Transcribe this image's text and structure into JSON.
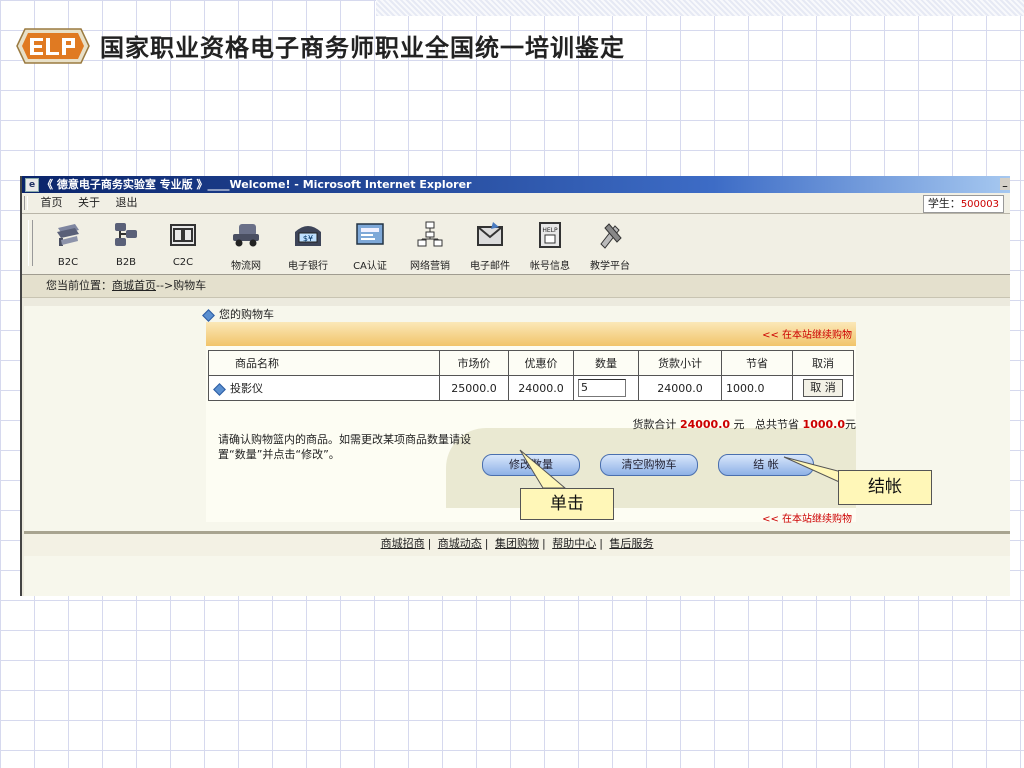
{
  "slide": {
    "title": "国家职业资格电子商务师职业全国统一培训鉴定"
  },
  "browser": {
    "window_title": "《 德意电子商务实验室 专业版 》____Welcome! - Microsoft Internet Explorer",
    "menu": [
      "首页",
      "关于",
      "退出"
    ],
    "student_label": "学生：",
    "student_id": "500003"
  },
  "toolbar": {
    "items": [
      {
        "label": "B2C",
        "icon": "b2c-icon"
      },
      {
        "label": "B2B",
        "icon": "b2b-icon"
      },
      {
        "label": "C2C",
        "icon": "c2c-icon"
      },
      {
        "label": "物流网",
        "icon": "logistics-icon"
      },
      {
        "label": "电子银行",
        "icon": "bank-icon"
      },
      {
        "label": "CA认证",
        "icon": "ca-icon"
      },
      {
        "label": "网络营销",
        "icon": "marketing-icon"
      },
      {
        "label": "电子邮件",
        "icon": "email-icon"
      },
      {
        "label": "帐号信息",
        "icon": "account-icon"
      },
      {
        "label": "教学平台",
        "icon": "teaching-icon"
      }
    ]
  },
  "location": {
    "prefix": "您当前位置：",
    "link": "商城首页",
    "suffix": "-->购物车"
  },
  "cart": {
    "heading": "您的购物车",
    "continue_top": "<< 在本站继续购物",
    "continue_bottom": "<< 在本站继续购物",
    "columns": [
      "商品名称",
      "市场价",
      "优惠价",
      "数量",
      "货款小计",
      "节省",
      "取消"
    ],
    "items": [
      {
        "name": "投影仪",
        "market_price": "25000.0",
        "sale_price": "24000.0",
        "quantity": "5",
        "subtotal": "24000.0",
        "saving": "1000.0",
        "cancel": "取 消"
      }
    ],
    "total_label": "货款合计",
    "total_value": "24000.0",
    "total_unit": "元",
    "saving_label": "总共节省",
    "saving_value": "1000.0",
    "saving_unit": "元",
    "note": "请确认购物篮内的商品。如需更改某项商品数量请设置“数量”并点击“修改”。",
    "buttons": {
      "update": "修改数量",
      "clear": "清空购物车",
      "checkout": "结 帐"
    }
  },
  "footer": {
    "links": [
      "商城招商",
      "商城动态",
      "集团购物",
      "帮助中心",
      "售后服务"
    ]
  },
  "callouts": {
    "click": "单击",
    "checkout": "结帐"
  }
}
